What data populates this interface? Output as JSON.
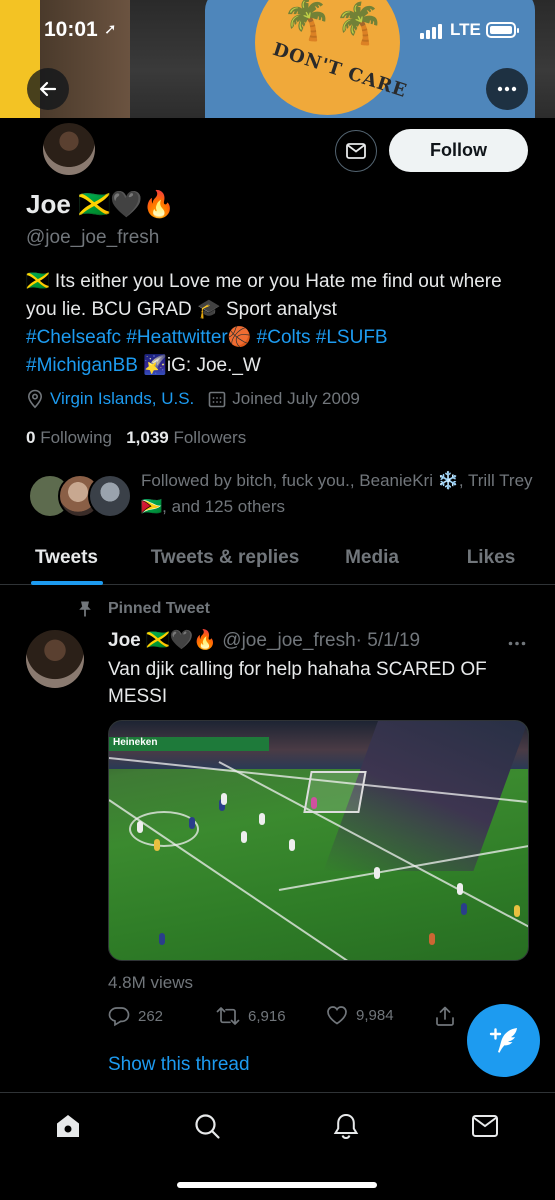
{
  "status_bar": {
    "time": "10:01",
    "network": "LTE"
  },
  "banner": {
    "shirt_text": "DON'T CARE"
  },
  "header": {
    "follow_label": "Follow"
  },
  "profile": {
    "name": "Joe 🇯🇲🖤🔥",
    "handle": "@joe_joe_fresh",
    "bio_line1": "🇯🇲 Its either you Love me or you Hate me find out where you lie. BCU GRAD 🎓 Sport analyst",
    "bio_tags_line": [
      "#Chelseafc",
      "#Heattwitter🏀",
      "#Colts",
      "#LSUFB",
      "#MichiganBB"
    ],
    "bio_tail": "🌠iG: Joe._W",
    "location": "Virgin Islands, U.S.",
    "joined": "Joined July 2009",
    "following_count": "0",
    "following_label": "Following",
    "followers_count": "1,039",
    "followers_label": "Followers",
    "followed_by": "Followed by bitch, fuck you., BeanieKri ❄️, Trill Trey 🇬🇾, and 125 others"
  },
  "tabs": [
    {
      "label": "Tweets",
      "active": true
    },
    {
      "label": "Tweets & replies",
      "active": false
    },
    {
      "label": "Media",
      "active": false
    },
    {
      "label": "Likes",
      "active": false
    }
  ],
  "tweet": {
    "pinned_label": "Pinned Tweet",
    "author_name": "Joe 🇯🇲🖤🔥",
    "author_handle": "@joe_joe_fresh",
    "date": "· 5/1/19",
    "text": "Van djik calling for help hahaha SCARED OF MESSI",
    "media_board_text": "Heineken",
    "views": "4.8M views",
    "replies": "262",
    "retweets": "6,916",
    "likes": "9,984",
    "show_thread": "Show this thread"
  },
  "colors": {
    "accent": "#1d9bf0",
    "background": "#000000",
    "secondary_text": "#71767b"
  }
}
